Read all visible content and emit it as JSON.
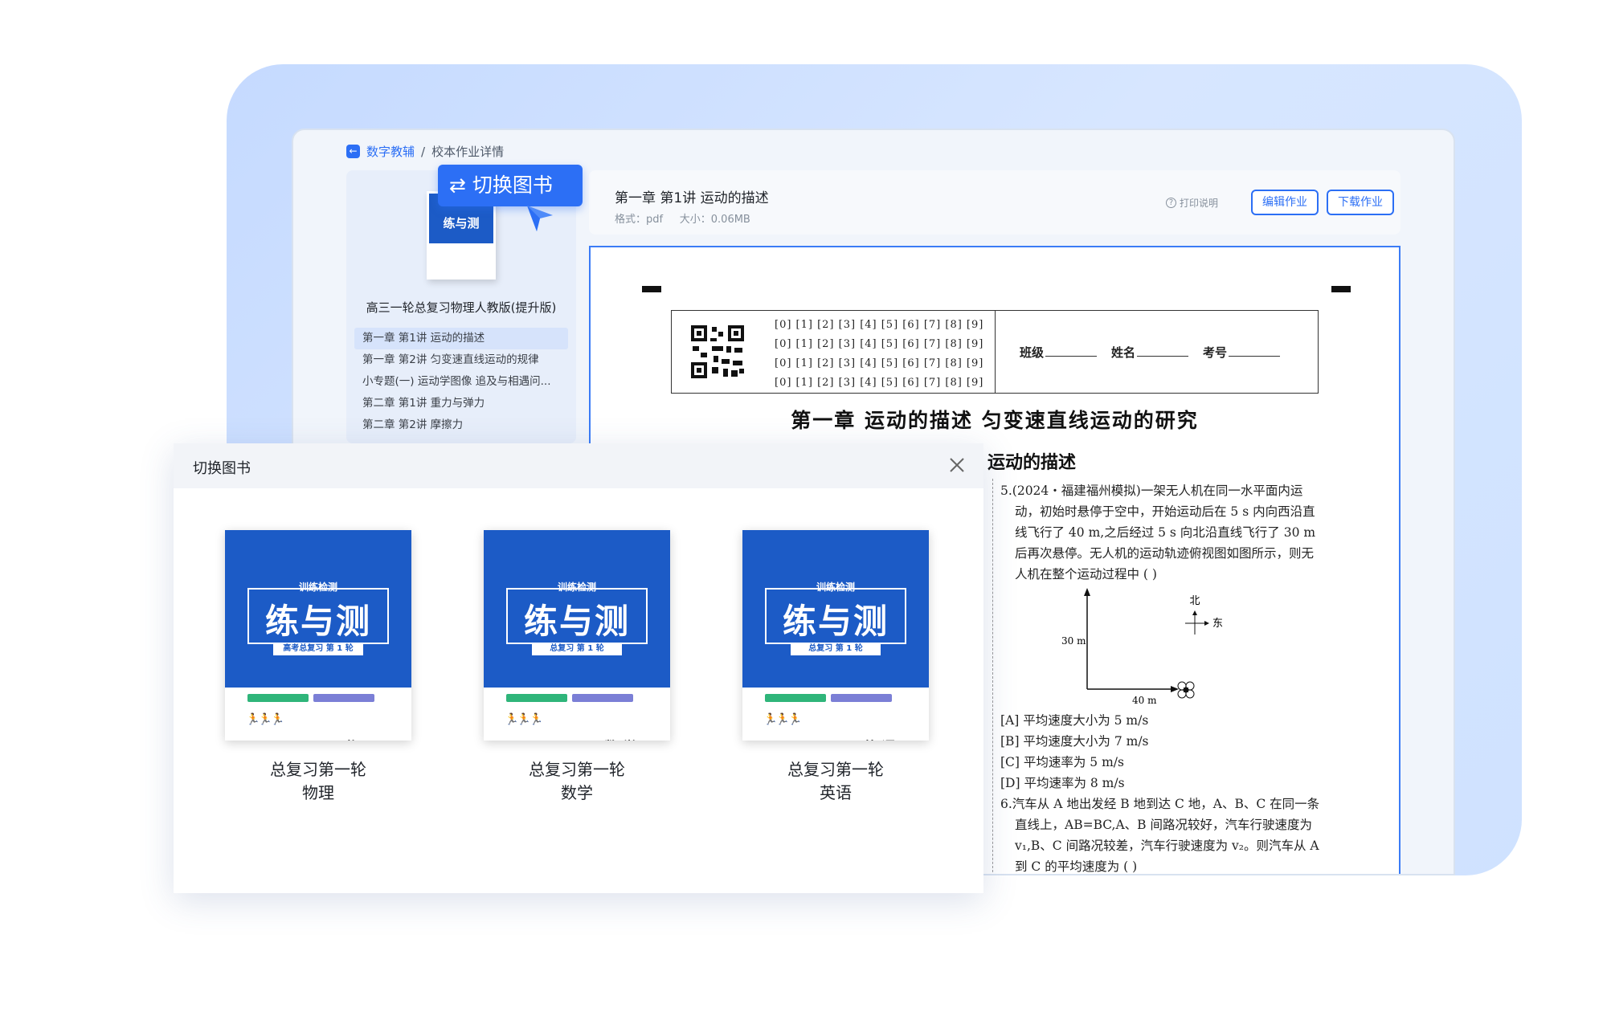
{
  "breadcrumb": {
    "root": "数字教辅",
    "sep": "/",
    "current": "校本作业详情"
  },
  "sidebar": {
    "mini_cover_text": "练与测",
    "book_title": "高三一轮总复习物理人教版(提升版)",
    "items": [
      {
        "label": "第一章  第1讲  运动的描述",
        "active": true
      },
      {
        "label": "第一章  第2讲  匀变速直线运动的规律"
      },
      {
        "label": "小专题(一)  运动学图像  追及与相遇问..."
      },
      {
        "label": "第二章  第1讲  重力与弹力"
      },
      {
        "label": "第二章  第2讲  摩擦力"
      }
    ]
  },
  "switch_badge": {
    "icon": "swap-icon",
    "label": "切换图书"
  },
  "doc": {
    "title": "第一章  第1讲  运动的描述",
    "format": "格式：pdf",
    "size": "大小：0.06MB",
    "print_help": "打印说明",
    "edit_label": "编辑作业",
    "download_label": "下载作业"
  },
  "paper": {
    "digit_rows": [
      "[0] [1] [2] [3] [4] [5] [6] [7] [8] [9]",
      "[0] [1] [2] [3] [4] [5] [6] [7] [8] [9]",
      "[0] [1] [2] [3] [4] [5] [6] [7] [8] [9]",
      "[0] [1] [2] [3] [4] [5] [6] [7] [8] [9]"
    ],
    "class_label": "班级",
    "name_label": "姓名",
    "exam_label": "考号",
    "chapter_title": "第一章  运动的描述  匀变速直线运动的研究",
    "section_title": "运动的描述",
    "q5": "5.(2024・福建福州模拟)一架无人机在同一水平面内运动，初始时悬停于空中，开始运动后在 5 s 内向西沿直线飞行了 40 m,之后经过 5 s 向北沿直线飞行了 30 m 后再次悬停。无人机的运动轨迹俯视图如图所示，则无人机在整个运动过程中        (    )",
    "diagram": {
      "north": "北",
      "east": "东",
      "y_label": "30 m",
      "x_label": "40 m"
    },
    "options": [
      "[A] 平均速度大小为 5 m/s",
      "[B] 平均速度大小为 7 m/s",
      "[C] 平均速率为 5 m/s",
      "[D] 平均速率为 8 m/s"
    ],
    "q6": "6.汽车从 A 地出发经 B 地到达 C 地，A、B、C 在同一条直线上，AB=BC,A、B 间路况较好，汽车行驶速度为 v₁,B、C 间路况较差，汽车行驶速度为 v₂。则汽车从 A 到 C 的平均速度为        (    )"
  },
  "modal": {
    "title": "切换图书",
    "books": [
      {
        "cover_tag": "训练检测",
        "cover_title": "练与测",
        "cover_sub": "高考总复习  第 1 轮",
        "subject_print": "物理",
        "line1": "总复习第一轮",
        "line2": "物理"
      },
      {
        "cover_tag": "训练检测",
        "cover_title": "练与测",
        "cover_sub": "总复习  第 1 轮",
        "subject_print": "数学",
        "line1": "总复习第一轮",
        "line2": "数学"
      },
      {
        "cover_tag": "训练检测",
        "cover_title": "练与测",
        "cover_sub": "总复习  第 1 轮",
        "subject_print": "英语",
        "line1": "总复习第一轮",
        "line2": "英语"
      }
    ]
  },
  "colors": {
    "accent": "#2c6ff5",
    "cover_blue": "#1c5bc6",
    "bar_green": "#2fb57a",
    "bar_purple": "#7b7fd6"
  }
}
